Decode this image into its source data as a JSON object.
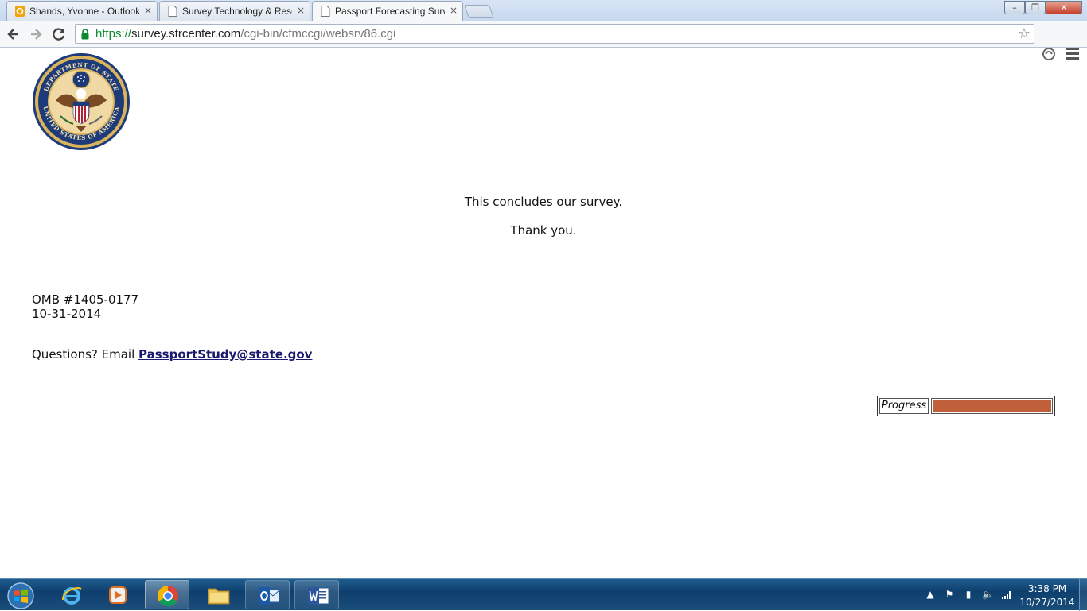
{
  "browser": {
    "tabs": [
      {
        "title": "Shands, Yvonne - Outlook",
        "favicon": "outlook-icon"
      },
      {
        "title": "Survey Technology & Research",
        "favicon": "page-icon"
      },
      {
        "title": "Passport Forecasting Survey",
        "favicon": "page-icon",
        "active": true
      }
    ],
    "close_glyph": "×",
    "url": {
      "scheme": "https://",
      "host": "survey.strcenter.com",
      "path": "/cgi-bin/cfmccgi/websrv86.cgi"
    },
    "window_controls": {
      "minimize": "–",
      "restore": "❐",
      "close": "✕"
    }
  },
  "page": {
    "seal": {
      "name": "department-of-state-seal",
      "text_top": "DEPARTMENT OF STATE",
      "text_bottom": "UNITED STATES OF AMERICA"
    },
    "conclusion": "This concludes our survey.",
    "thanks": "Thank you.",
    "omb_number": "OMB #1405-0177",
    "omb_date": "10-31-2014",
    "questions_prefix": "Questions? Email ",
    "contact_email": "PassportStudy@state.gov",
    "progress": {
      "label": "Progress",
      "value_percent": 100,
      "color": "#c0603b"
    }
  },
  "taskbar": {
    "apps": [
      "internet-explorer-icon",
      "media-player-icon",
      "chrome-icon",
      "file-explorer-icon",
      "outlook-icon",
      "word-icon"
    ],
    "active_app": "chrome-icon",
    "clock": {
      "time": "3:38 PM",
      "date": "10/27/2014"
    }
  }
}
